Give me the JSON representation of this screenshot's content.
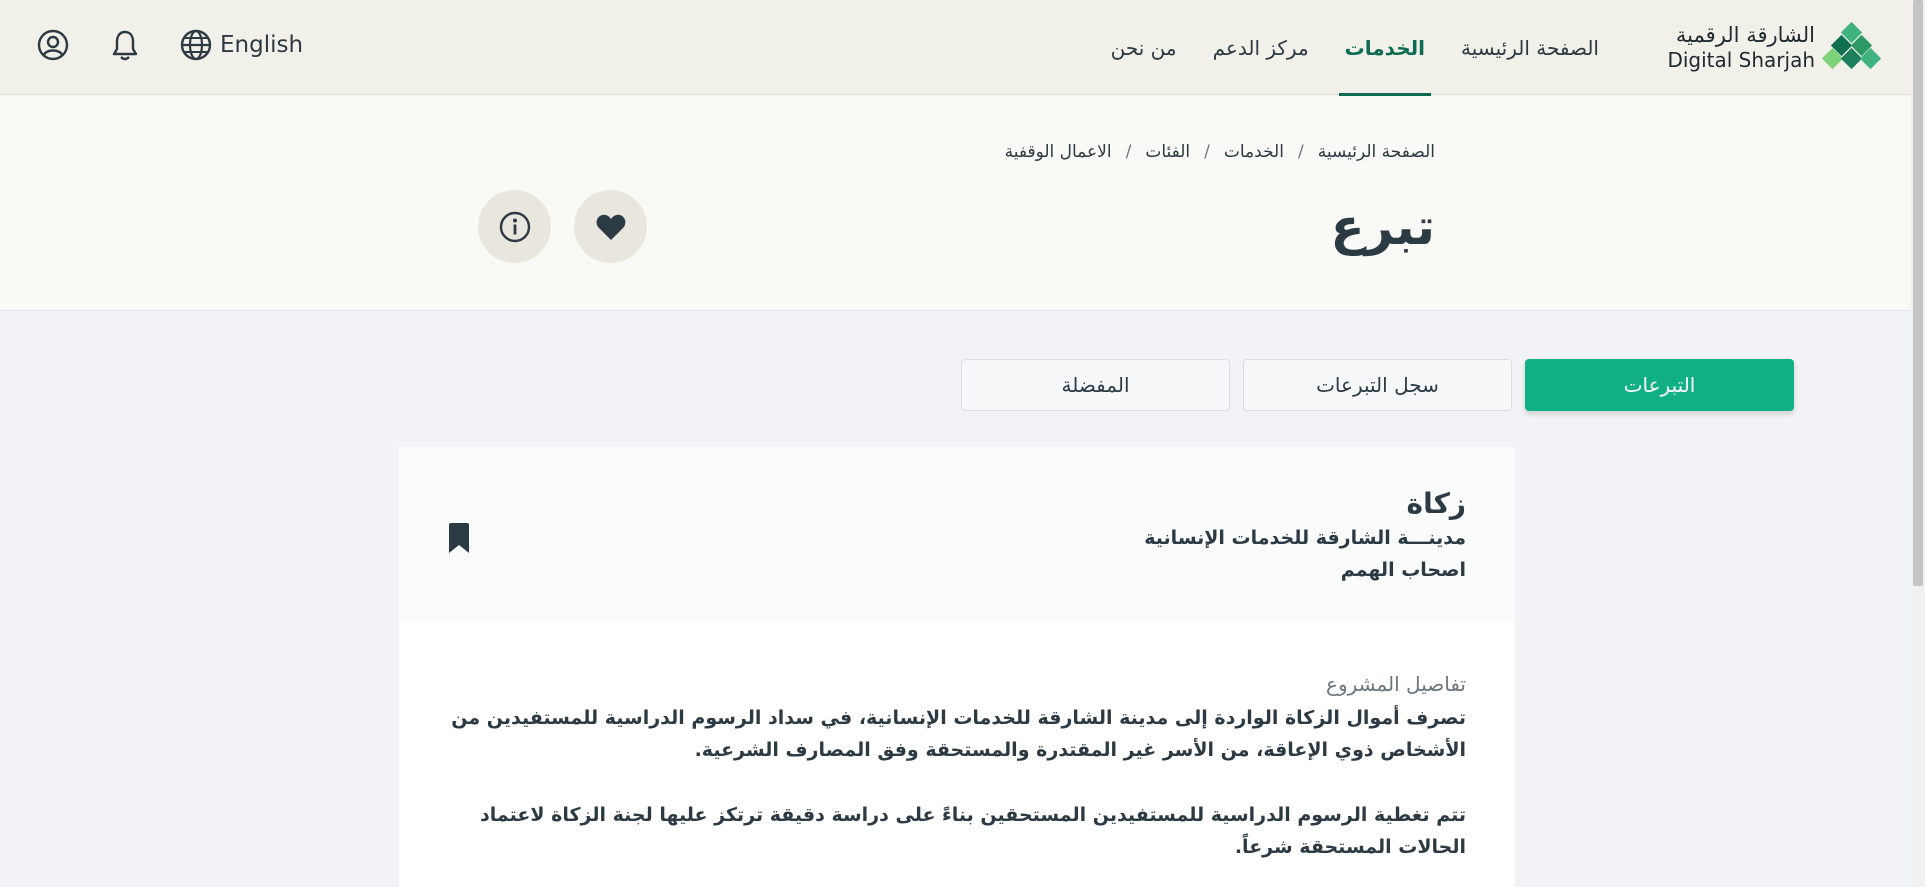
{
  "header": {
    "logo_ar": "الشارقة الرقمية",
    "logo_en": "Digital Sharjah",
    "nav": [
      {
        "label": "الصفحة الرئيسية"
      },
      {
        "label": "الخدمات"
      },
      {
        "label": "مركز الدعم"
      },
      {
        "label": "من نحن"
      }
    ],
    "active_nav": "الخدمات",
    "language_label": "English",
    "icons": [
      "globe-icon",
      "bell-icon",
      "user-icon"
    ]
  },
  "breadcrumb": [
    "الصفحة الرئيسية",
    "الخدمات",
    "الفئات",
    "الاعمال الوقفية"
  ],
  "breadcrumb_separator": "/",
  "page_title": "تبرع",
  "title_actions": [
    "heart-icon",
    "info-icon"
  ],
  "tabs": [
    {
      "label": "التبرعات"
    },
    {
      "label": "سجل التبرعات"
    },
    {
      "label": "المفضلة"
    }
  ],
  "active_tab": "التبرعات",
  "card": {
    "title": "زكاة",
    "organization": "مدينـــة الشارقة للخدمات الإنسانية",
    "category": "اصحاب الهمم",
    "details_label": "تفاصيل المشروع",
    "paragraphs": [
      "تصرف أموال الزكاة الواردة إلى مدينة الشارقة للخدمات الإنسانية، في سداد الرسوم الدراسية للمستفيدين من الأشخاص ذوي الإعاقة، من الأسر غير المقتدرة والمستحقة وفق المصارف الشرعية.",
      "تتم تغطية الرسوم الدراسية للمستفيدين المستحقين بناءً على دراسة دقيقة ترتكز عليها لجنة الزكاة لاعتماد الحالات المستحقة شرعاً."
    ]
  },
  "colors": {
    "brand_green": "#0b6b53",
    "accent_green": "#11b084",
    "topbar_bg": "#f1f0e9"
  }
}
